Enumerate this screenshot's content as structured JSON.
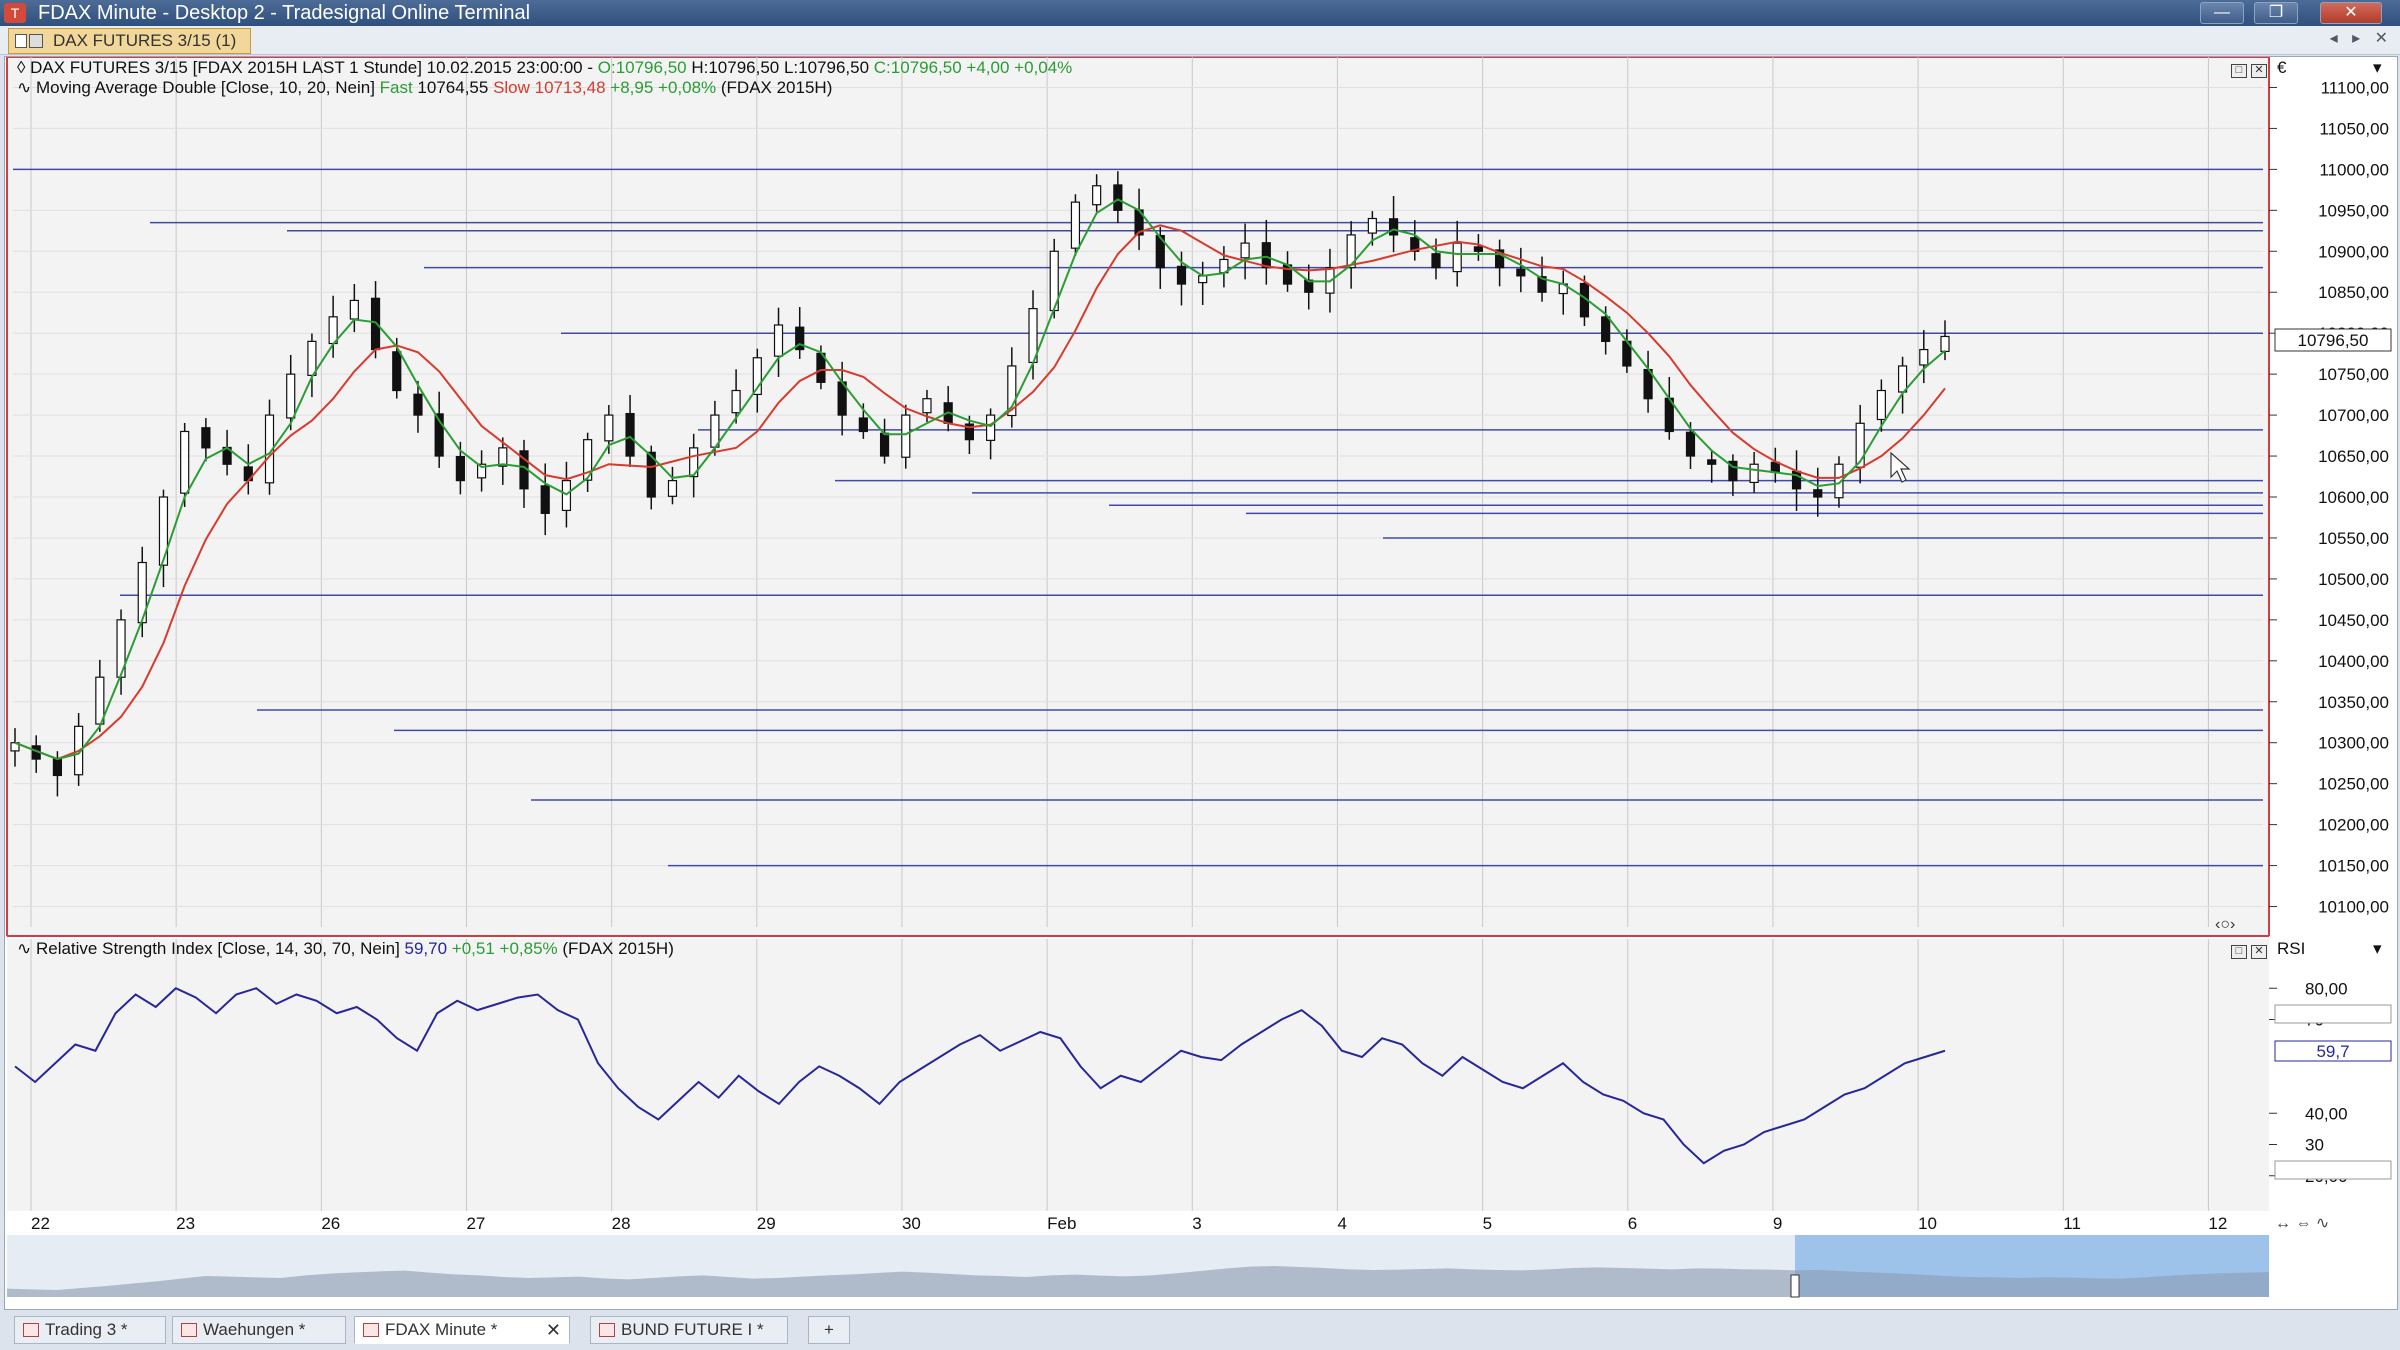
{
  "window": {
    "title": "FDAX Minute - Desktop 2 - Tradesignal Online Terminal",
    "controls": [
      "—",
      "❐",
      "✕"
    ]
  },
  "doc_tab": {
    "label": "DAX FUTURES 3/15 (1)"
  },
  "price_pane": {
    "header": {
      "symbol_info": "DAX FUTURES 3/15 [FDAX 2015H LAST 1 Stunde] 10.02.2015 23:00:00 - ",
      "open": "O:10796,50",
      "high_low": " H:10796,50 L:10796,50 ",
      "close": "C:10796,50 +4,00 +0,04%"
    },
    "ma_header": {
      "name": "Moving Average Double [Close, 10, 20, Nein] ",
      "fast_label": "Fast",
      "fast_value": " 10764,55 ",
      "slow_label": "Slow",
      "slow_value": " 10713,48 ",
      "slow_change": "+8,95 +0,08%",
      "contract": " (FDAX 2015H)"
    },
    "axis_header": "€",
    "current_price_label": "10796,50"
  },
  "rsi_pane": {
    "header": {
      "name": "Relative Strength Index [Close, 14, 30, 70, Nein] ",
      "value": "59,70",
      "change": " +0,51 +0,85%",
      "contract": " (FDAX 2015H)"
    },
    "axis_header": "RSI",
    "current_label": "59,7"
  },
  "chart_data": [
    {
      "type": "candlestick",
      "title": "DAX FUTURES 3/15 [FDAX 2015H LAST 1 Stunde]",
      "ylim": [
        10075,
        11125
      ],
      "y_ticks": [
        "11100,00",
        "11050,00",
        "11000,00",
        "10950,00",
        "10900,00",
        "10850,00",
        "10800,00",
        "10750,00",
        "10700,00",
        "10650,00",
        "10600,00",
        "10550,00",
        "10500,00",
        "10450,00",
        "10400,00",
        "10350,00",
        "10300,00",
        "10250,00",
        "10200,00",
        "10150,00",
        "10100,00"
      ],
      "x_labels": [
        "22",
        "23",
        "26",
        "27",
        "28",
        "29",
        "30",
        "Feb",
        "3",
        "4",
        "5",
        "6",
        "9",
        "10",
        "11",
        "12"
      ],
      "series_points": [
        10300,
        10280,
        10260,
        10320,
        10380,
        10450,
        10520,
        10600,
        10680,
        10660,
        10640,
        10620,
        10700,
        10750,
        10790,
        10820,
        10840,
        10780,
        10730,
        10700,
        10650,
        10620,
        10640,
        10660,
        10610,
        10580,
        10620,
        10670,
        10700,
        10650,
        10600,
        10620,
        10660,
        10700,
        10730,
        10770,
        10810,
        10780,
        10740,
        10700,
        10680,
        10650,
        10700,
        10720,
        10690,
        10670,
        10700,
        10760,
        10830,
        10900,
        10960,
        10980,
        10950,
        10920,
        10880,
        10860,
        10870,
        10890,
        10910,
        10880,
        10860,
        10850,
        10880,
        10920,
        10940,
        10920,
        10900,
        10880,
        10910,
        10900,
        10880,
        10870,
        10850,
        10860,
        10820,
        10790,
        10760,
        10720,
        10680,
        10650,
        10640,
        10620,
        10640,
        10630,
        10610,
        10600,
        10640,
        10690,
        10730,
        10760,
        10780,
        10796
      ],
      "series": [
        {
          "name": "Fast",
          "last": 10764.55,
          "color": "#2a9d34"
        },
        {
          "name": "Slow",
          "last": 10713.48,
          "color": "#d83a2e"
        }
      ],
      "horizontal_lines": [
        11000,
        10935,
        10925,
        10880,
        10800,
        10682,
        10620,
        10605,
        10590,
        10580,
        10550,
        10480,
        10340,
        10315,
        10230,
        10150
      ],
      "last_price": 10796.5
    },
    {
      "type": "line",
      "title": "Relative Strength Index [Close, 14, 30, 70, Nein]",
      "ylim": [
        10,
        90
      ],
      "y_ticks": [
        "80,00",
        "70",
        "40,00",
        "30",
        "20,00"
      ],
      "levels": [
        30,
        70
      ],
      "values": [
        55,
        50,
        56,
        62,
        60,
        72,
        78,
        74,
        80,
        77,
        72,
        78,
        80,
        75,
        78,
        76,
        72,
        74,
        70,
        64,
        60,
        72,
        76,
        73,
        75,
        77,
        78,
        73,
        70,
        56,
        48,
        42,
        38,
        44,
        50,
        45,
        52,
        47,
        43,
        50,
        55,
        52,
        48,
        43,
        50,
        54,
        58,
        62,
        65,
        60,
        63,
        66,
        64,
        55,
        48,
        52,
        50,
        55,
        60,
        58,
        57,
        62,
        66,
        70,
        73,
        68,
        60,
        58,
        64,
        62,
        56,
        52,
        58,
        54,
        50,
        48,
        52,
        56,
        50,
        46,
        44,
        40,
        38,
        30,
        24,
        28,
        30,
        34,
        36,
        38,
        42,
        46,
        48,
        52,
        56,
        58,
        60
      ],
      "color": "#27279a",
      "last": 59.7
    }
  ],
  "bottom_tabs": [
    {
      "label": "Trading 3 *"
    },
    {
      "label": "Waehungen *"
    },
    {
      "label": "FDAX Minute *"
    },
    {
      "label": "BUND FUTURE I *"
    }
  ]
}
